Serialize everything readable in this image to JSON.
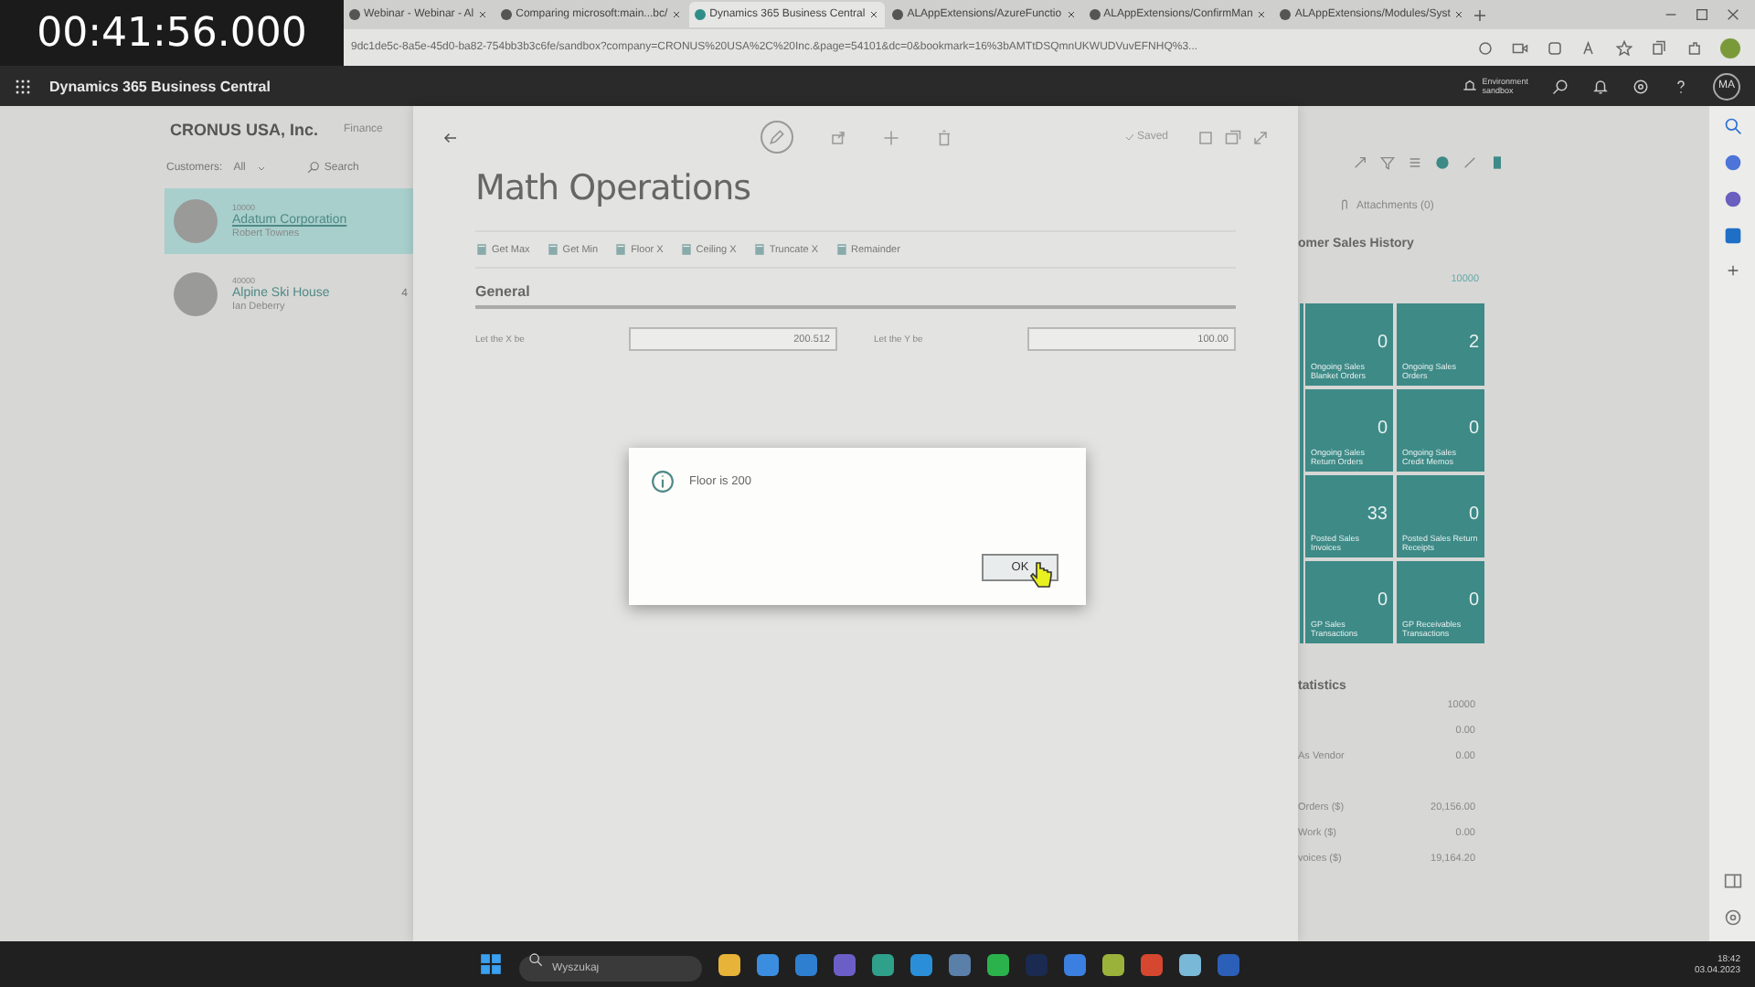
{
  "timestamp": "00:41:56.000",
  "browser": {
    "tabs": [
      {
        "title": "Webinar - Webinar - Al",
        "selected": false
      },
      {
        "title": "Comparing microsoft:main...bc/",
        "selected": false
      },
      {
        "title": "Dynamics 365 Business Central",
        "selected": true
      },
      {
        "title": "ALAppExtensions/AzureFunctio",
        "selected": false
      },
      {
        "title": "ALAppExtensions/ConfirmMan",
        "selected": false
      },
      {
        "title": "ALAppExtensions/Modules/Syst",
        "selected": false
      }
    ],
    "url": "9dc1de5c-8a5e-45d0-ba82-754bb3b3c6fe/sandbox?company=CRONUS%20USA%2C%20Inc.&page=54101&dc=0&bookmark=16%3bAMTtDSQmnUKWUDVuvEFNHQ%3..."
  },
  "app_header": {
    "title": "Dynamics 365 Business Central",
    "environment_label": "Environment",
    "environment_name": "sandbox",
    "user_initials": "MA"
  },
  "company": {
    "name": "CRONUS USA, Inc.",
    "nav_item": "Finance"
  },
  "customer_filter": {
    "label": "Customers:",
    "value": "All",
    "search_label": "Search"
  },
  "customers": [
    {
      "number": "10000",
      "name": "Adatum Corporation",
      "contact": "Robert Townes",
      "selected": true
    },
    {
      "number": "40000",
      "name": "Alpine Ski House",
      "contact": "Ian Deberry",
      "column_2": "4",
      "selected": false
    }
  ],
  "math_page": {
    "status": "Saved",
    "title": "Math Operations",
    "actions": [
      "Get Max",
      "Get Min",
      "Floor X",
      "Ceiling X",
      "Truncate X",
      "Remainder"
    ],
    "section": "General",
    "fields": [
      {
        "label": "Let the X be",
        "value": "200.512"
      },
      {
        "label": "Let the Y be",
        "value": "100.00"
      }
    ]
  },
  "factbox": {
    "attachments": "Attachments (0)",
    "history_title": "omer Sales History",
    "customer_no": "10000",
    "tiles": [
      {
        "value": "0",
        "label": "Ongoing Sales Blanket Orders"
      },
      {
        "value": "2",
        "label": "Ongoing Sales Orders"
      },
      {
        "value": "0",
        "label": "Ongoing Sales Return Orders"
      },
      {
        "value": "0",
        "label": "Ongoing Sales Credit Memos"
      },
      {
        "value": "33",
        "label": "Posted Sales Invoices"
      },
      {
        "value": "0",
        "label": "Posted Sales Return Receipts"
      },
      {
        "value": "0",
        "label": "GP Sales Transactions"
      },
      {
        "value": "0",
        "label": "GP Receivables Transactions"
      }
    ],
    "stats_title": "tatistics",
    "stats": [
      {
        "value": "10000"
      },
      {
        "value": "0.00"
      },
      {
        "label": "As Vendor",
        "value": "0.00"
      },
      {
        "label": "Orders ($)",
        "value": "20,156.00"
      },
      {
        "label": "Work ($)",
        "value": "0.00"
      },
      {
        "label": "voices ($)",
        "value": "19,164.20"
      }
    ]
  },
  "dialog": {
    "message": "Floor is 200",
    "button": "OK"
  },
  "taskbar": {
    "search_placeholder": "Wyszukaj",
    "time": "18:42",
    "date": "03.04.2023"
  }
}
